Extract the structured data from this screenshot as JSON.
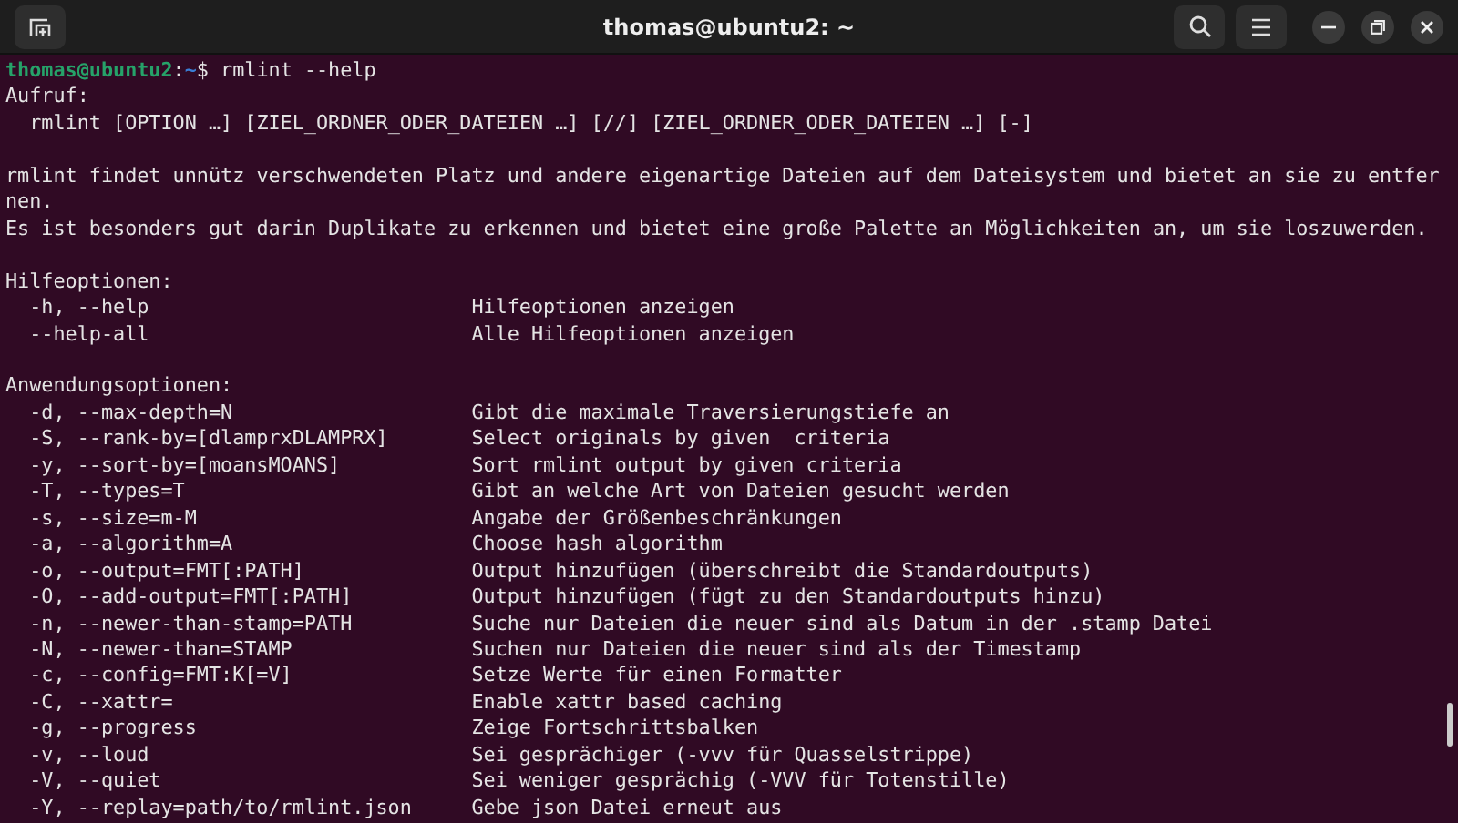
{
  "window": {
    "title": "thomas@ubuntu2: ~"
  },
  "terminal": {
    "lines": [
      {
        "kind": "prompt",
        "user": "thomas@ubuntu2",
        "separator": ":",
        "path": "~",
        "symbol": "$",
        "command": "rmlint --help"
      },
      {
        "kind": "text",
        "text": "Aufruf:"
      },
      {
        "kind": "text",
        "text": "  rmlint [OPTION …] [ZIEL_ORDNER_ODER_DATEIEN …] [//] [ZIEL_ORDNER_ODER_DATEIEN …] [-]"
      },
      {
        "kind": "blank"
      },
      {
        "kind": "text",
        "text": "rmlint findet unnütz verschwendeten Platz und andere eigenartige Dateien auf dem Dateisystem und bietet an sie zu entfer"
      },
      {
        "kind": "text",
        "text": "nen."
      },
      {
        "kind": "text",
        "text": "Es ist besonders gut darin Duplikate zu erkennen und bietet eine große Palette an Möglichkeiten an, um sie loszuwerden."
      },
      {
        "kind": "blank"
      },
      {
        "kind": "text",
        "text": "Hilfeoptionen:"
      },
      {
        "kind": "option",
        "option": "-h, --help",
        "description": "Hilfeoptionen anzeigen"
      },
      {
        "kind": "option",
        "option": "--help-all",
        "description": "Alle Hilfeoptionen anzeigen"
      },
      {
        "kind": "blank"
      },
      {
        "kind": "text",
        "text": "Anwendungsoptionen:"
      },
      {
        "kind": "option",
        "option": "-d, --max-depth=N",
        "description": "Gibt die maximale Traversierungstiefe an"
      },
      {
        "kind": "option",
        "option": "-S, --rank-by=[dlamprxDLAMPRX]",
        "description": "Select originals by given  criteria"
      },
      {
        "kind": "option",
        "option": "-y, --sort-by=[moansMOANS]",
        "description": "Sort rmlint output by given criteria"
      },
      {
        "kind": "option",
        "option": "-T, --types=T",
        "description": "Gibt an welche Art von Dateien gesucht werden"
      },
      {
        "kind": "option",
        "option": "-s, --size=m-M",
        "description": "Angabe der Größenbeschränkungen"
      },
      {
        "kind": "option",
        "option": "-a, --algorithm=A",
        "description": "Choose hash algorithm"
      },
      {
        "kind": "option",
        "option": "-o, --output=FMT[:PATH]",
        "description": "Output hinzufügen (überschreibt die Standardoutputs)"
      },
      {
        "kind": "option",
        "option": "-O, --add-output=FMT[:PATH]",
        "description": "Output hinzufügen (fügt zu den Standardoutputs hinzu)"
      },
      {
        "kind": "option",
        "option": "-n, --newer-than-stamp=PATH",
        "description": "Suche nur Dateien die neuer sind als Datum in der .stamp Datei"
      },
      {
        "kind": "option",
        "option": "-N, --newer-than=STAMP",
        "description": "Suchen nur Dateien die neuer sind als der Timestamp"
      },
      {
        "kind": "option",
        "option": "-c, --config=FMT:K[=V]",
        "description": "Setze Werte für einen Formatter"
      },
      {
        "kind": "option",
        "option": "-C, --xattr=",
        "description": "Enable xattr based caching"
      },
      {
        "kind": "option",
        "option": "-g, --progress",
        "description": "Zeige Fortschrittsbalken"
      },
      {
        "kind": "option",
        "option": "-v, --loud",
        "description": "Sei gesprächiger (-vvv für Quasselstrippe)"
      },
      {
        "kind": "option",
        "option": "-V, --quiet",
        "description": "Sei weniger gesprächig (-VVV für Totenstille)"
      },
      {
        "kind": "option",
        "option": "-Y, --replay=path/to/rmlint.json",
        "description": "Gebe json Datei erneut aus"
      }
    ]
  }
}
